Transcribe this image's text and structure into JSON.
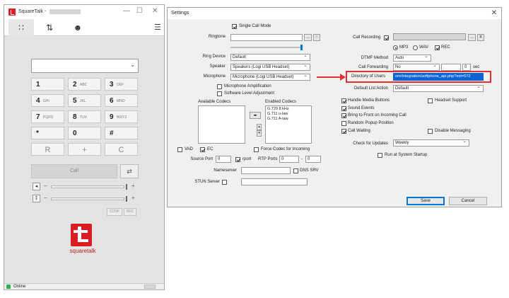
{
  "phone": {
    "title": "SquareTalk -",
    "win_min": "—",
    "win_max": "☐",
    "win_close": "✕",
    "tabs": [
      {
        "icon": "dialpad-icon",
        "glyph": "∷"
      },
      {
        "icon": "call-history-icon",
        "glyph": "⇅"
      },
      {
        "icon": "contacts-icon",
        "glyph": "☻"
      }
    ],
    "menu_glyph": "☰",
    "combo_arrow": "⌄",
    "keys": [
      {
        "d": "1",
        "l": ""
      },
      {
        "d": "2",
        "l": "ABC"
      },
      {
        "d": "3",
        "l": "DEF"
      },
      {
        "d": "4",
        "l": "GHI"
      },
      {
        "d": "5",
        "l": "JKL"
      },
      {
        "d": "6",
        "l": "MNO"
      },
      {
        "d": "7",
        "l": "PQRS"
      },
      {
        "d": "8",
        "l": "TUV"
      },
      {
        "d": "9",
        "l": "WXYZ"
      },
      {
        "d": "*",
        "l": ""
      },
      {
        "d": "0",
        "l": ""
      },
      {
        "d": "#",
        "l": ""
      }
    ],
    "soft_keys": [
      "R",
      "+",
      "C"
    ],
    "call_label": "Call",
    "transfer_glyph": "⇄",
    "speaker_glyph": "◂",
    "mic_glyph": "‡",
    "minus": "–",
    "plus": "+",
    "conf_label": "CONF",
    "rec_label": "REC",
    "brand": "squaretalk",
    "status": "Online"
  },
  "settings": {
    "title": "Settings",
    "close_glyph": "✕",
    "single_call_mode": "Single Call Mode",
    "ringtone_label": "Ringtone",
    "browse": "...",
    "clear": "X",
    "ring_device_label": "Ring Device",
    "ring_device_value": "Default",
    "speaker_label": "Speaker",
    "speaker_value": "Speakers (Logi USB Headset)",
    "microphone_label": "Microphone",
    "microphone_value": "Microphone (Logi USB Headset)",
    "mic_amplification": "Microphone Amplification",
    "software_level_adjustment": "Software Level Adjustment",
    "available_codecs": "Available Codecs",
    "enabled_codecs": "Enabled Codecs",
    "codecs": [
      "G.729 8 kHz",
      "G.711 u-law",
      "G.711 A-law"
    ],
    "move_glyph": "◂▸",
    "up_glyph": "▴",
    "down_glyph": "▾",
    "vad": "VAD",
    "ec": "EC",
    "force_codec": "Force Codec for Incoming",
    "source_port_label": "Source Port",
    "source_port_value": "0",
    "rport": "rport",
    "rtp_ports_label": "RTP Ports",
    "rtp_from": "0",
    "rtp_dash": "-",
    "rtp_to": "0",
    "nameserver_label": "Nameserver",
    "dns_srv": "DNS SRV",
    "stun_label": "STUN Server",
    "call_recording_label": "Call Recording",
    "mp3": "MP3",
    "wav": "WAV",
    "rec": "REC",
    "dtmf_label": "DTMF Method",
    "dtmf_value": "Auto",
    "call_forwarding_label": "Call Forwarding",
    "call_forwarding_value": "No",
    "forward_delay": "0",
    "sec": "sec",
    "dou_label": "Directory of Users",
    "dou_value": "om/Integration/softphone_api.php?ext=572",
    "default_list_action_label": "Default List Action",
    "default_list_action_value": "Default",
    "handle_media_buttons": "Handle Media Buttons",
    "headset_support": "Headset Support",
    "sound_events": "Sound Events",
    "bring_to_front": "Bring to Front on Incoming Call",
    "random_popup": "Random Popup Position",
    "call_waiting": "Call Waiting",
    "disable_messaging": "Disable Messaging",
    "check_updates_label": "Check for Updates",
    "check_updates_value": "Weekly",
    "run_at_startup": "Run at System Startup",
    "save": "Save",
    "cancel": "Cancel"
  },
  "colors": {
    "brand_red": "#d81e23",
    "highlight": "#e03030",
    "selection_blue": "#0a64d8",
    "online_green": "#2bb24c"
  }
}
